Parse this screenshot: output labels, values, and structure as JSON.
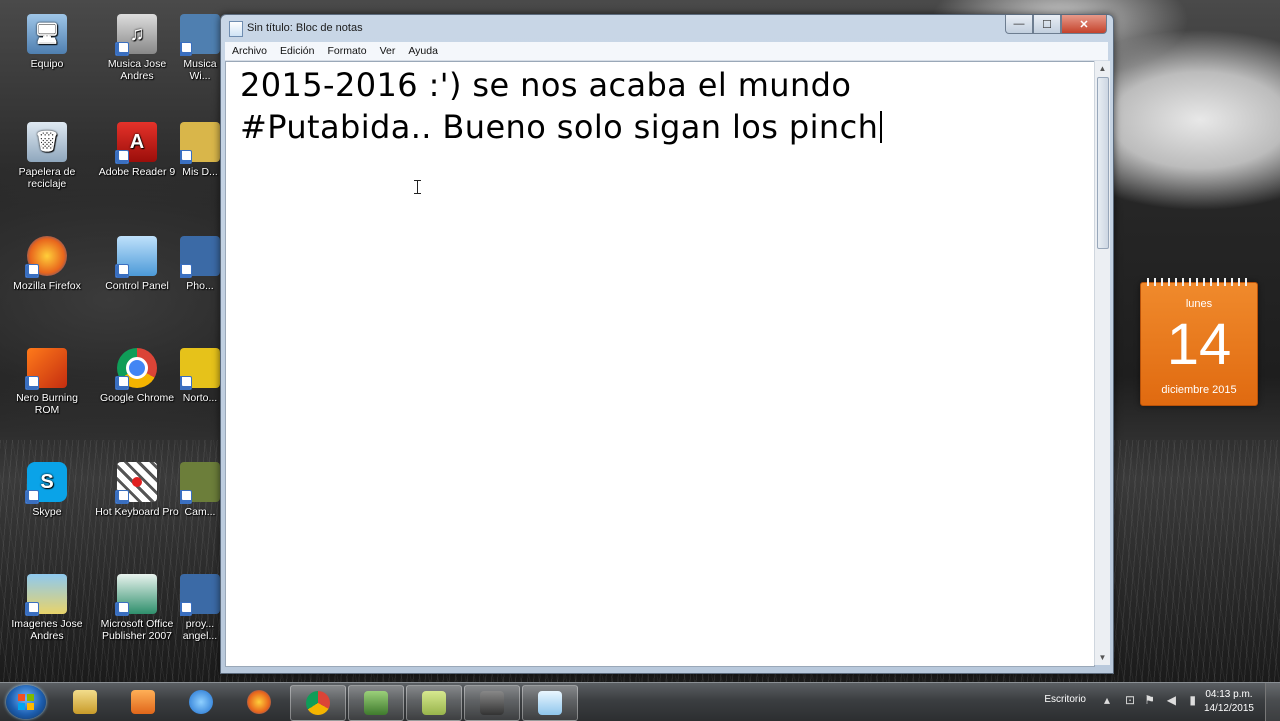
{
  "desktop": {
    "icons": [
      {
        "label": "Equipo"
      },
      {
        "label": "Musica Jose Andres"
      },
      {
        "label": "Musica Wi..."
      },
      {
        "label": "Papelera de reciclaje"
      },
      {
        "label": "Adobe Reader 9"
      },
      {
        "label": "Mis D..."
      },
      {
        "label": "Mozilla Firefox"
      },
      {
        "label": "Control Panel"
      },
      {
        "label": "Pho..."
      },
      {
        "label": "Nero Burning ROM"
      },
      {
        "label": "Google Chrome"
      },
      {
        "label": "Norto..."
      },
      {
        "label": "Skype"
      },
      {
        "label": "Hot Keyboard Pro"
      },
      {
        "label": "Cam..."
      },
      {
        "label": "Imagenes Jose Andres"
      },
      {
        "label": "Microsoft Office Publisher 2007"
      },
      {
        "label": "proy... angel..."
      }
    ]
  },
  "notepad": {
    "title": "Sin título: Bloc de notas",
    "menu": [
      "Archivo",
      "Edición",
      "Formato",
      "Ver",
      "Ayuda"
    ],
    "window_buttons": {
      "minimize": "—",
      "maximize": "☐",
      "close": "✕"
    },
    "content_lines": [
      "2015-2016 :') se nos acaba el mundo",
      "#Putabida.. Bueno solo sigan los pinch"
    ]
  },
  "calendar_gadget": {
    "day_name": "lunes",
    "day_number": "14",
    "month_year": "diciembre 2015"
  },
  "taskbar": {
    "apps": [
      {
        "name": "file-explorer",
        "color": "#e8c560"
      },
      {
        "name": "media-player",
        "color": "#f07b1c"
      },
      {
        "name": "internet-explorer",
        "color": "#2f8fe0"
      },
      {
        "name": "firefox",
        "color": "#e8651c"
      },
      {
        "name": "chrome",
        "color": "#4caf50"
      },
      {
        "name": "app-green-console",
        "color": "#4c8a3a"
      },
      {
        "name": "app-notes",
        "color": "#a9c46a"
      },
      {
        "name": "camera-recorder",
        "color": "#555555"
      },
      {
        "name": "notepad",
        "color": "#9fd0f0"
      }
    ],
    "tray": {
      "escritorio_label": "Escritorio",
      "time": "04:13 p.m.",
      "date": "14/12/2015"
    }
  }
}
